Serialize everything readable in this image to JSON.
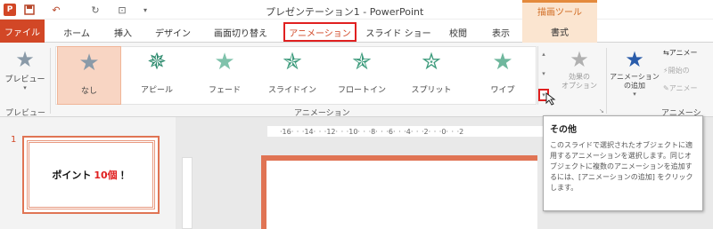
{
  "qat": {
    "title": "プレゼンテーション1 - PowerPoint",
    "context_group": "描画ツール",
    "app_icon": "P",
    "icons": [
      "powerpoint-icon",
      "save-icon",
      "undo-icon",
      "redo-icon",
      "presentation-icon",
      "customize-icon"
    ]
  },
  "tabs": [
    "ファイル",
    "ホーム",
    "挿入",
    "デザイン",
    "画面切り替え",
    "アニメーション",
    "スライド ショー",
    "校閲",
    "表示",
    "書式"
  ],
  "ribbon": {
    "preview_label": "プレビュー",
    "preview_group": "プレビュー",
    "gallery": [
      {
        "label": "なし",
        "color": "#8a9aa8"
      },
      {
        "label": "アピール",
        "color": "#2e8b6e"
      },
      {
        "label": "フェード",
        "color": "#3d9b7c"
      },
      {
        "label": "スライドイン",
        "color": "#3d9b7c"
      },
      {
        "label": "フロートイン",
        "color": "#3d9b7c"
      },
      {
        "label": "スプリット",
        "color": "#3d9b7c"
      },
      {
        "label": "ワイプ",
        "color": "#3d9b7c"
      }
    ],
    "effect_options": "効果の\nオプション",
    "animation_group": "アニメーション",
    "add_animation": "アニメーション\nの追加",
    "add_animation_arrow": "▾",
    "adv_group": "アニメーシ",
    "right_items": [
      "アニメー",
      "開始の",
      "アニメー"
    ]
  },
  "slide": {
    "number": "1",
    "thumb_text_1": "ポイント",
    "thumb_text_red": "10個",
    "thumb_text_2": "！",
    "ruler": "·16· · ·14· · ·12· · ·10· · ·8· · ·6· · ·4· · ·2· · ·0· · ·2"
  },
  "tooltip": {
    "title": "その他",
    "body": "このスライドで選択されたオブジェクトに適用するアニメーションを選択します。同じオブジェクトに複数のアニメーションを追加するには、[アニメーションの追加] をクリックします。"
  }
}
